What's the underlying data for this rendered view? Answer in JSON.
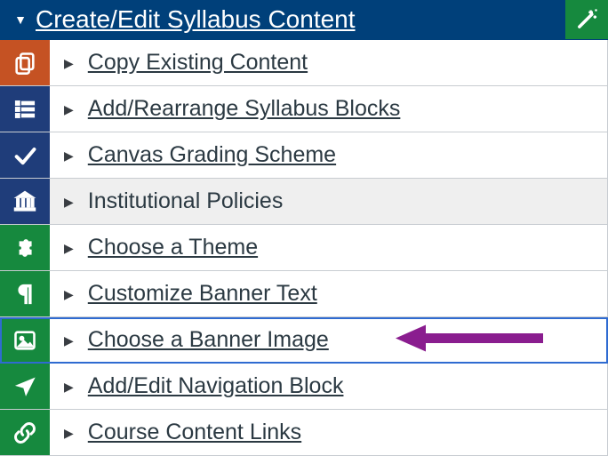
{
  "header": {
    "title": "Create/Edit Syllabus Content"
  },
  "items": [
    {
      "label": "Copy Existing Content",
      "icon": "copy",
      "color": "orange"
    },
    {
      "label": "Add/Rearrange Syllabus Blocks",
      "icon": "stack",
      "color": "navy"
    },
    {
      "label": "Canvas Grading Scheme",
      "icon": "check",
      "color": "navy"
    },
    {
      "label": "Institutional Policies",
      "icon": "bank",
      "color": "navy",
      "hovered": true,
      "nolink": true
    },
    {
      "label": "Choose a Theme",
      "icon": "puzzle",
      "color": "green"
    },
    {
      "label": "Customize Banner Text",
      "icon": "para",
      "color": "green"
    },
    {
      "label": "Choose a Banner Image",
      "icon": "image",
      "color": "green",
      "selected": true,
      "arrow": true
    },
    {
      "label": "Add/Edit Navigation Block",
      "icon": "nav",
      "color": "green"
    },
    {
      "label": "Course Content Links",
      "icon": "link",
      "color": "green"
    }
  ],
  "annotation": {
    "arrow_color": "#8a1d8f"
  }
}
